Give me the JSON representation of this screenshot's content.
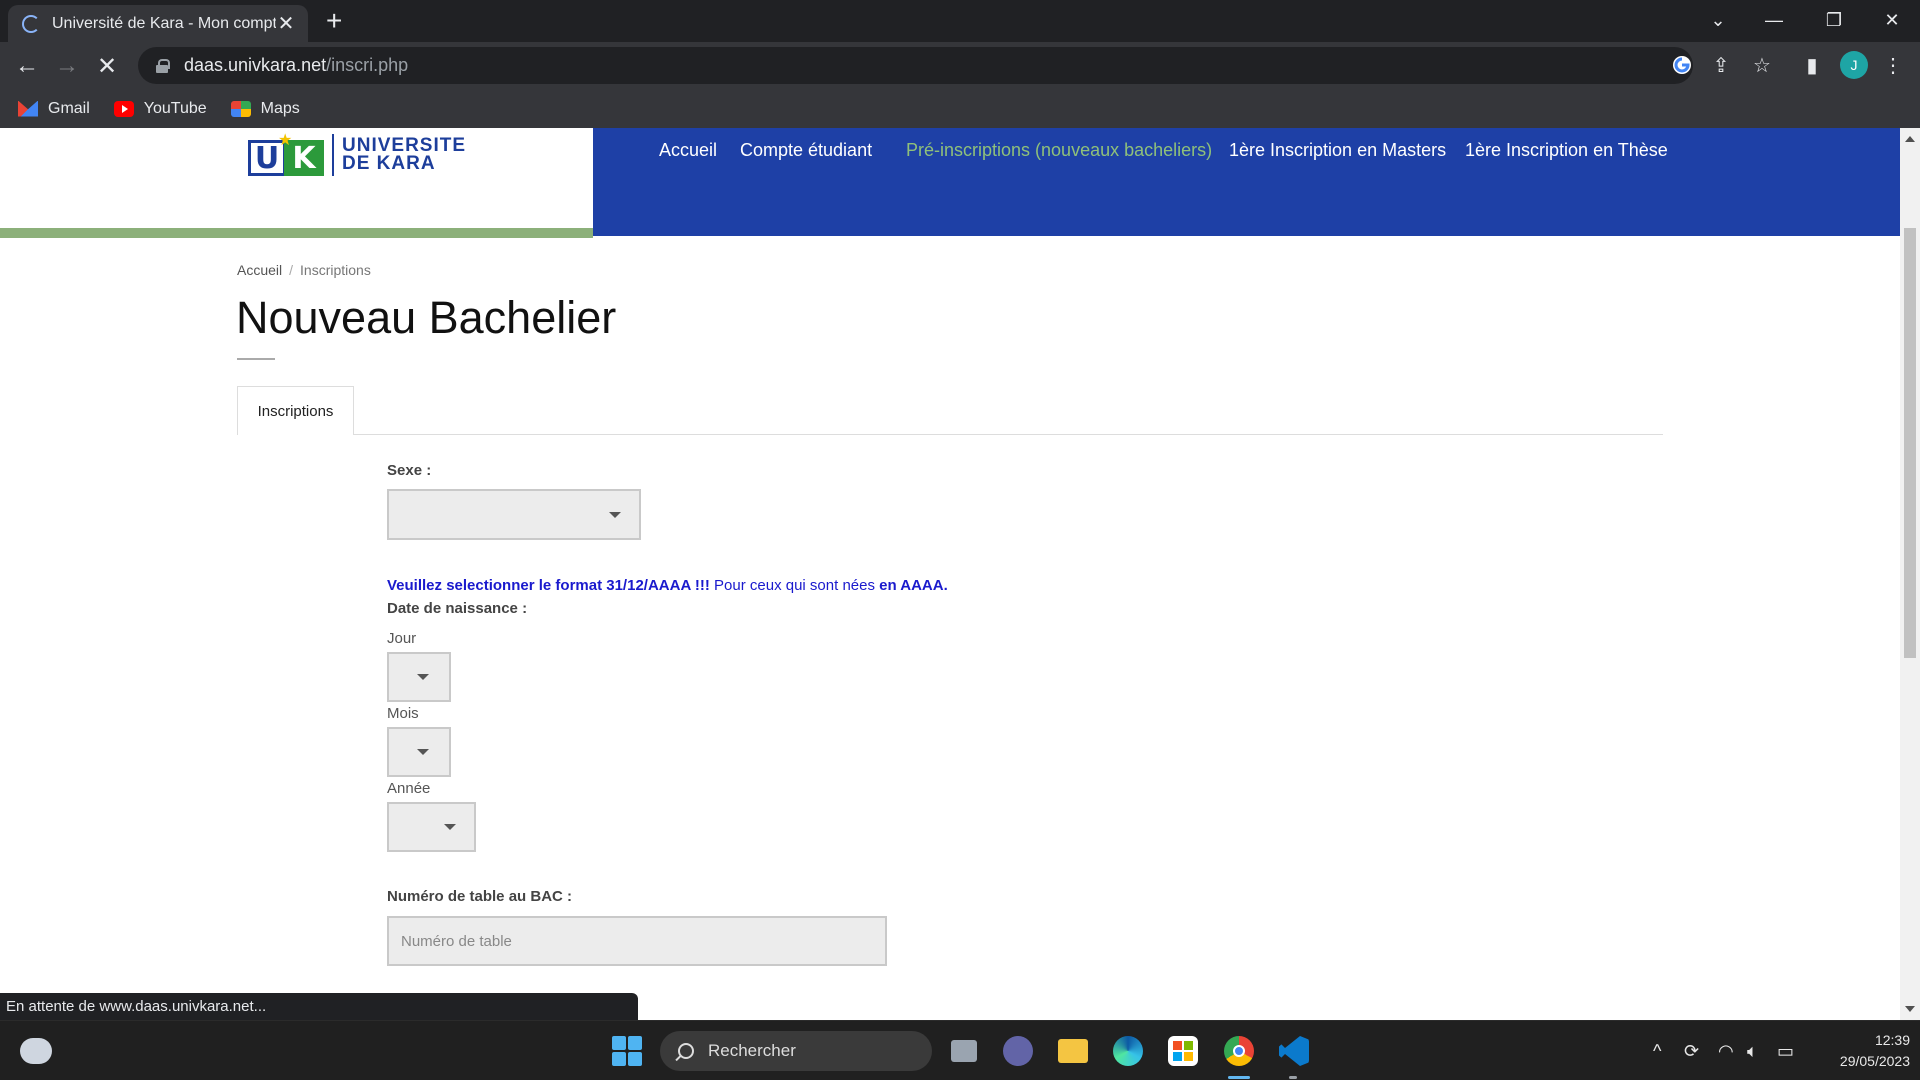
{
  "browser": {
    "tab_title": "Université de Kara - Mon compte",
    "tab_close": "✕",
    "new_tab": "+",
    "url_host": "daas.univkara.net",
    "url_path": "/inscri.php",
    "avatar_letter": "J",
    "bookmarks": [
      {
        "label": "Gmail",
        "icon": "gmail-icon"
      },
      {
        "label": "YouTube",
        "icon": "youtube-icon"
      },
      {
        "label": "Maps",
        "icon": "maps-icon"
      }
    ],
    "status_text": "En attente de www.daas.univkara.net..."
  },
  "site": {
    "logo_line1": "UNIVERSITE",
    "logo_line2": "DE KARA",
    "logo_mark_u": "U",
    "logo_mark_k": "K",
    "nav": [
      {
        "label": "Accueil",
        "active": false
      },
      {
        "label": "Compte étudiant",
        "active": false
      },
      {
        "label": "Pré-inscriptions (nouveaux bacheliers)",
        "active": true
      },
      {
        "label": "1ère Inscription en Masters",
        "active": false
      },
      {
        "label": "1ère Inscription en Thèse",
        "active": false
      }
    ],
    "colors": {
      "nav_bg": "#1e40a6",
      "accent_green": "#8cb07a",
      "notice_blue": "#1a1acd"
    }
  },
  "page": {
    "breadcrumb": [
      "Accueil",
      "Inscriptions"
    ],
    "breadcrumb_sep": "/",
    "title": "Nouveau Bachelier",
    "tab": "Inscriptions",
    "form": {
      "sexe_label": "Sexe :",
      "sexe_value": "",
      "notice_part1": "Veuillez selectionner le format 31/12/AAAA !!!",
      "notice_part2": " Pour ceux qui sont nées ",
      "notice_part3": "en AAAA.",
      "dob_label": "Date de naissance :",
      "jour_label": "Jour",
      "mois_label": "Mois",
      "annee_label": "Année",
      "bac_label": "Numéro de table au BAC :",
      "bac_placeholder": "Numéro de table",
      "bac_value": ""
    }
  },
  "taskbar": {
    "search_label": "Rechercher",
    "time": "12:39",
    "date": "29/05/2023",
    "apps": [
      "task-view-icon",
      "teams-icon",
      "file-explorer-icon",
      "edge-icon",
      "store-icon",
      "chrome-icon",
      "vscode-icon"
    ]
  }
}
